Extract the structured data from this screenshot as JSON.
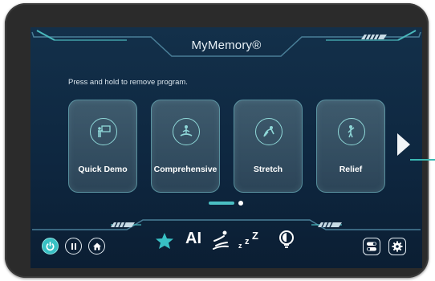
{
  "header": {
    "title": "MyMemory®"
  },
  "hint_text": "Press and hold to remove program.",
  "programs": [
    {
      "label": "Quick Demo",
      "icon": "presentation-icon"
    },
    {
      "label": "Comprehensive",
      "icon": "meditation-icon"
    },
    {
      "label": "Stretch",
      "icon": "stretch-icon"
    },
    {
      "label": "Relief",
      "icon": "relief-icon"
    }
  ],
  "pager": {
    "pages": 2,
    "current": 1
  },
  "bottom": {
    "ai_label": "AI",
    "icons": [
      "power-icon",
      "pause-icon",
      "home-icon",
      "star-icon",
      "ai-label",
      "body-massage-icon",
      "sleep-icon",
      "light-bulb-icon",
      "toggle-settings-icon",
      "gear-icon"
    ]
  },
  "colors": {
    "accent": "#38c0c4",
    "screen_bg": "#0e2740",
    "bezel": "#2b2b2b"
  }
}
